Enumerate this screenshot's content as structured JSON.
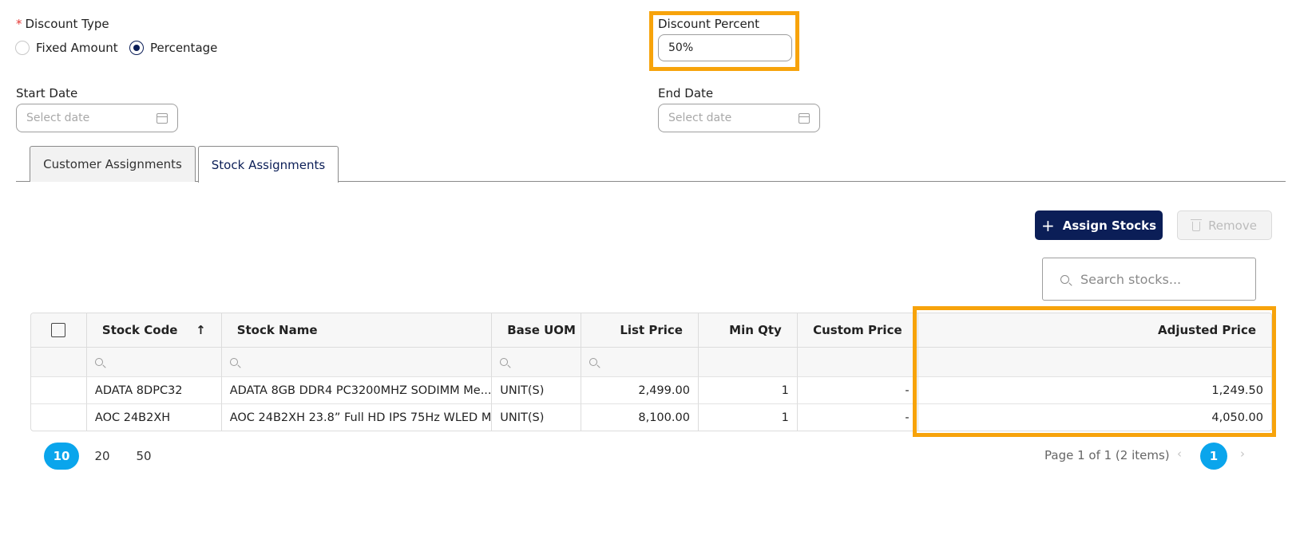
{
  "form": {
    "discount_type": {
      "required_mark": "*",
      "label": "Discount Type",
      "options": [
        {
          "label": "Fixed Amount",
          "selected": false
        },
        {
          "label": "Percentage",
          "selected": true
        }
      ]
    },
    "discount_percent": {
      "label": "Discount Percent",
      "value": "50%"
    },
    "start_date": {
      "label": "Start Date",
      "placeholder": "Select date"
    },
    "end_date": {
      "label": "End Date",
      "placeholder": "Select date"
    }
  },
  "tabs": [
    {
      "label": "Customer Assignments",
      "active": false
    },
    {
      "label": "Stock Assignments",
      "active": true
    }
  ],
  "toolbar": {
    "assign_label": "Assign Stocks",
    "remove_label": "Remove",
    "search_placeholder": "Search stocks..."
  },
  "grid": {
    "columns": [
      "Stock Code",
      "Stock Name",
      "Base UOM",
      "List Price",
      "Min Qty",
      "Custom Price",
      "Adjusted Price"
    ],
    "sort": {
      "column": "Stock Code",
      "direction": "ascending"
    },
    "rows": [
      {
        "stock_code": "ADATA 8DPC32",
        "stock_name": "ADATA 8GB DDR4 PC3200MHZ SODIMM Me...",
        "base_uom": "UNIT(S)",
        "list_price": "2,499.00",
        "min_qty": "1",
        "custom_price": "-",
        "adjusted_price": "1,249.50"
      },
      {
        "stock_code": "AOC 24B2XH",
        "stock_name": "AOC 24B2XH 23.8” Full HD IPS 75Hz WLED M...",
        "base_uom": "UNIT(S)",
        "list_price": "8,100.00",
        "min_qty": "1",
        "custom_price": "-",
        "adjusted_price": "4,050.00"
      }
    ]
  },
  "pager": {
    "page_sizes": [
      "10",
      "20",
      "50"
    ],
    "selected_size": "10",
    "info": "Page 1 of 1 (2 items)",
    "current_page": "1",
    "prev_arrow": "‹",
    "next_arrow": "›"
  },
  "colors": {
    "primary": "#0b1e57",
    "accent": "#0aa5ec",
    "highlight": "#f7a30b"
  }
}
